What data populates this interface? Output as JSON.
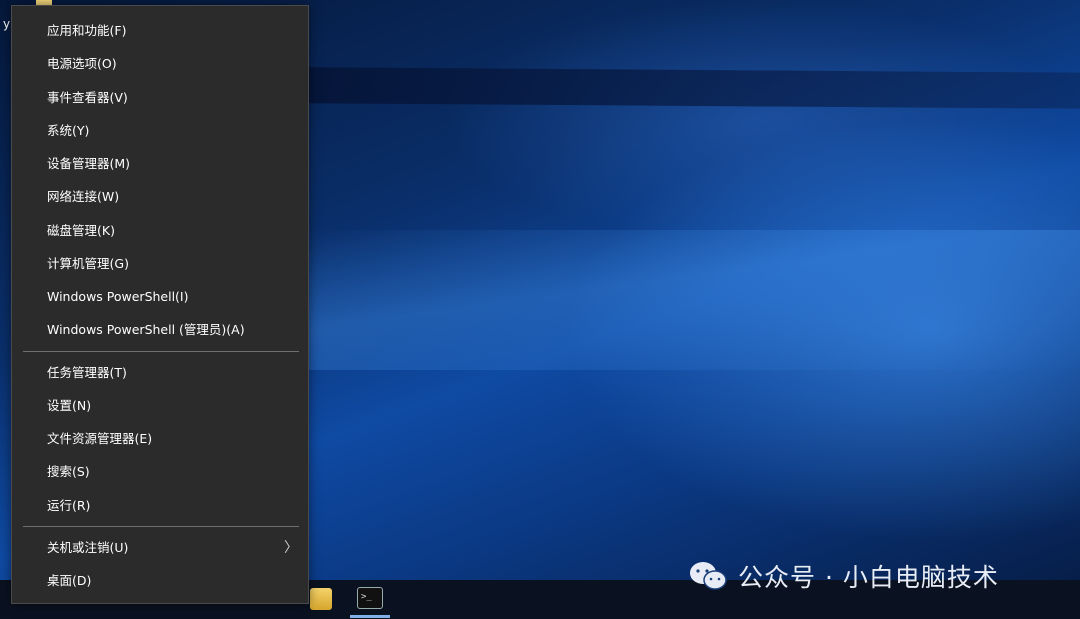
{
  "desktop": {
    "fragment_text": "y"
  },
  "menu": {
    "group1": [
      {
        "label": "应用和功能(F)"
      },
      {
        "label": "电源选项(O)"
      },
      {
        "label": "事件查看器(V)"
      },
      {
        "label": "系统(Y)"
      },
      {
        "label": "设备管理器(M)"
      },
      {
        "label": "网络连接(W)"
      },
      {
        "label": "磁盘管理(K)"
      },
      {
        "label": "计算机管理(G)"
      },
      {
        "label": "Windows PowerShell(I)"
      },
      {
        "label": "Windows PowerShell (管理员)(A)"
      }
    ],
    "group2": [
      {
        "label": "任务管理器(T)"
      },
      {
        "label": "设置(N)"
      },
      {
        "label": "文件资源管理器(E)"
      },
      {
        "label": "搜索(S)"
      },
      {
        "label": "运行(R)"
      }
    ],
    "group3": [
      {
        "label": "关机或注销(U)",
        "submenu_glyph": "〉"
      },
      {
        "label": "桌面(D)"
      }
    ]
  },
  "taskbar": {
    "cmd_glyph": ">_"
  },
  "watermark": {
    "text": "公众号 · 小白电脑技术"
  }
}
